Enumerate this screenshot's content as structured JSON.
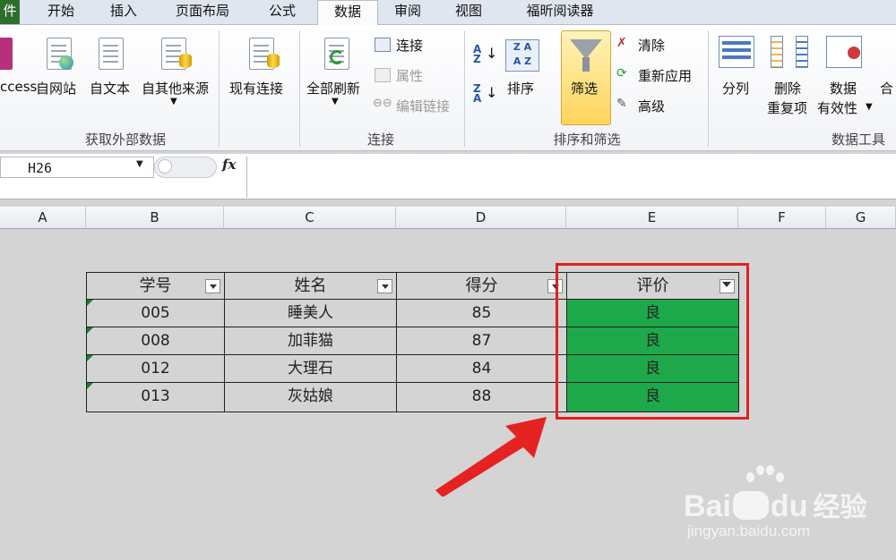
{
  "tabs": [
    "件",
    "开始",
    "插入",
    "页面布局",
    "公式",
    "数据",
    "审阅",
    "视图",
    "福昕阅读器"
  ],
  "ribbon": {
    "get_external": {
      "access": "ccess",
      "web": "自网站",
      "text": "自文本",
      "other": "自其他来源",
      "existing": "现有连接",
      "group": "获取外部数据"
    },
    "connections": {
      "refresh_all": "全部刷新",
      "connections": "连接",
      "properties": "属性",
      "edit_links": "编辑链接",
      "group": "连接"
    },
    "sort_filter": {
      "sort": "排序",
      "filter": "筛选",
      "clear": "清除",
      "reapply": "重新应用",
      "advanced": "高级",
      "group": "排序和筛选"
    },
    "data_tools": {
      "text_to_columns": "分列",
      "remove_dup_1": "删除",
      "remove_dup_2": "重复项",
      "validation_1": "数据",
      "validation_2": "有效性",
      "consolidate": "合",
      "group": "数据工具"
    }
  },
  "formula_bar": {
    "name_box": "H26",
    "fx": "fx"
  },
  "columns": [
    "A",
    "B",
    "C",
    "D",
    "E",
    "F",
    "G"
  ],
  "table": {
    "headers": [
      "学号",
      "姓名",
      "得分",
      "评价"
    ],
    "rows": [
      [
        "005",
        "睡美人",
        "85",
        "良"
      ],
      [
        "008",
        "加菲猫",
        "87",
        "良"
      ],
      [
        "012",
        "大理石",
        "84",
        "良"
      ],
      [
        "013",
        "灰姑娘",
        "88",
        "良"
      ]
    ]
  },
  "watermark": {
    "brand": "Bai",
    "brand2": "du",
    "cn": "经验",
    "url": "jingyan.baidu.com"
  },
  "colors": {
    "highlight": "#1da84a",
    "annotation": "#e02020",
    "file_tab": "#2c6f2c"
  }
}
